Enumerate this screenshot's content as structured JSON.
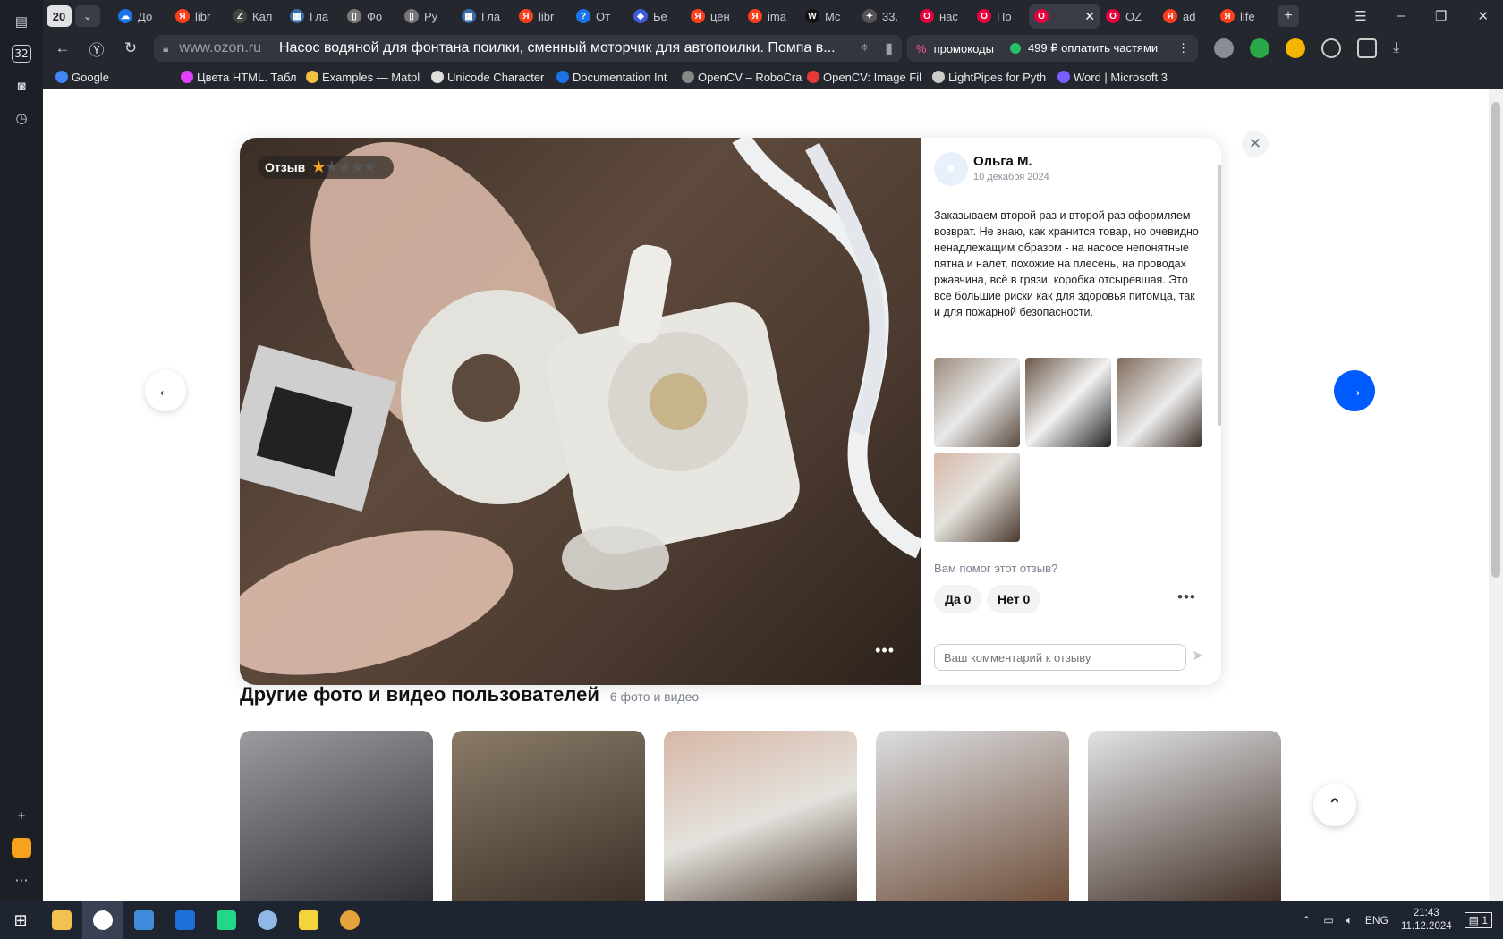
{
  "tabs": {
    "count": "20",
    "items": [
      {
        "label": "До",
        "color": "#1a73e8",
        "glyph": "☁"
      },
      {
        "label": "libr",
        "color": "#fc3f1d",
        "glyph": "Я"
      },
      {
        "label": "Кал",
        "color": "#444",
        "glyph": "Z"
      },
      {
        "label": "Гла",
        "color": "#3b6ea5",
        "glyph": "▦"
      },
      {
        "label": "Фо",
        "color": "#777",
        "glyph": "▯"
      },
      {
        "label": "Ру",
        "color": "#777",
        "glyph": "▯"
      },
      {
        "label": "Гла",
        "color": "#3b6ea5",
        "glyph": "▦"
      },
      {
        "label": "libr",
        "color": "#fc3f1d",
        "glyph": "Я"
      },
      {
        "label": "От",
        "color": "#1a73e8",
        "glyph": "?"
      },
      {
        "label": "Бе",
        "color": "#3c5bd6",
        "glyph": "◆"
      },
      {
        "label": "цен",
        "color": "#fc3f1d",
        "glyph": "Я"
      },
      {
        "label": "ima",
        "color": "#fc3f1d",
        "glyph": "Я"
      },
      {
        "label": "Mc",
        "color": "#111",
        "glyph": "W"
      },
      {
        "label": "33.",
        "color": "#555",
        "glyph": "✦"
      },
      {
        "label": "нас",
        "color": "#e8003d",
        "glyph": "O"
      },
      {
        "label": "По",
        "color": "#e8003d",
        "glyph": "O"
      },
      {
        "label": "",
        "color": "#e8003d",
        "glyph": "O",
        "active": true
      },
      {
        "label": "OZ",
        "color": "#e8003d",
        "glyph": "O"
      },
      {
        "label": "ad",
        "color": "#fc3f1d",
        "glyph": "Я"
      },
      {
        "label": "life",
        "color": "#fc3f1d",
        "glyph": "Я"
      }
    ]
  },
  "address": {
    "domain": "www.ozon.ru",
    "title": "Насос водяной для фонтана поилки, сменный моторчик для автопоилки. Помпа в...",
    "promo": "промокоды",
    "pay": "499 ₽ оплатить частями"
  },
  "bookmarks": [
    {
      "label": "Google",
      "color": "#4285f4"
    },
    {
      "label": "Цвета HTML. Табл",
      "color": "#e040fb"
    },
    {
      "label": "Examples — Matpl",
      "color": "#f0c040"
    },
    {
      "label": "Unicode Character",
      "color": "#ddd"
    },
    {
      "label": "Documentation Int",
      "color": "#1a73e8"
    },
    {
      "label": "OpenCV – RoboCra",
      "color": "#888"
    },
    {
      "label": "OpenCV: Image Fil",
      "color": "#e53935"
    },
    {
      "label": "LightPipes for Pyth",
      "color": "#ccc"
    },
    {
      "label": "Word | Microsoft 3",
      "color": "#7b5cff"
    }
  ],
  "review": {
    "badge": "Отзыв",
    "rating": 1,
    "author": "Ольга М.",
    "date": "10 декабря 2024",
    "text": "Заказываем второй раз и второй раз оформляем возврат. Не знаю, как хранится товар, но очевидно ненадлежащим образом - на насосе непонятные пятна и налет, похожие на плесень, на проводах ржавчина, всё в грязи, коробка отсыревшая. Это всё большие риски как для здоровья питомца, так и для пожарной безопасности.",
    "helpful_question": "Вам помог этот отзыв?",
    "yes": "Да 0",
    "no": "Нет 0",
    "comment_placeholder": "Ваш комментарий к отзыву"
  },
  "section": {
    "title": "Другие фото и видео пользователей",
    "count": "6 фото и видео"
  },
  "taskbar": {
    "lang": "ENG",
    "time": "21:43",
    "date": "11.12.2024",
    "notifications": "1"
  },
  "sidebar": {
    "badge": "32"
  }
}
